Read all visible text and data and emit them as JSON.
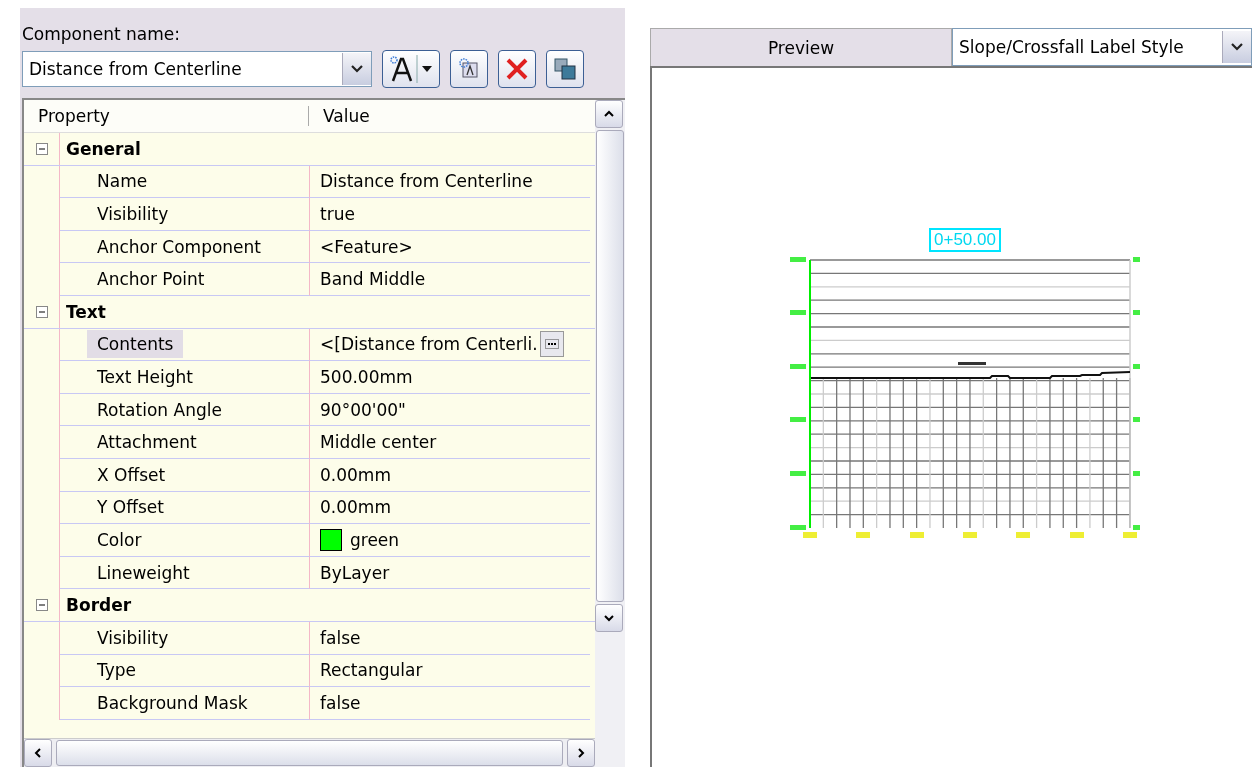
{
  "component": {
    "label": "Component name:",
    "value": "Distance from Centerline"
  },
  "grid": {
    "columns": [
      "Property",
      "Value"
    ],
    "categories": [
      {
        "label": "General",
        "expanded": true,
        "rows": [
          {
            "name": "Name",
            "value": "Distance from Centerline",
            "kind": "text",
            "selected": false
          },
          {
            "name": "Visibility",
            "value": "true",
            "kind": "text",
            "selected": false
          },
          {
            "name": "Anchor Component",
            "value": "<Feature>",
            "kind": "text",
            "selected": false
          },
          {
            "name": "Anchor Point",
            "value": "Band Middle",
            "kind": "text",
            "selected": false
          }
        ]
      },
      {
        "label": "Text",
        "expanded": true,
        "rows": [
          {
            "name": "Contents",
            "value": "<[Distance from Centerli.",
            "kind": "ellipsis",
            "selected": true
          },
          {
            "name": "Text Height",
            "value": "500.00mm",
            "kind": "text",
            "selected": false
          },
          {
            "name": "Rotation Angle",
            "value": "90°00'00\"",
            "kind": "text",
            "selected": false
          },
          {
            "name": "Attachment",
            "value": "Middle center",
            "kind": "text",
            "selected": false
          },
          {
            "name": "X Offset",
            "value": "0.00mm",
            "kind": "text",
            "selected": false
          },
          {
            "name": "Y Offset",
            "value": "0.00mm",
            "kind": "text",
            "selected": false
          },
          {
            "name": "Color",
            "value": "green",
            "kind": "color",
            "color": "#00ff00",
            "selected": false
          },
          {
            "name": "Lineweight",
            "value": "ByLayer",
            "kind": "text",
            "selected": false
          }
        ]
      },
      {
        "label": "Border",
        "expanded": true,
        "rows": [
          {
            "name": "Visibility",
            "value": "false",
            "kind": "text",
            "selected": false
          },
          {
            "name": "Type",
            "value": "Rectangular",
            "kind": "text",
            "selected": false
          },
          {
            "name": "Background Mask",
            "value": "false",
            "kind": "text",
            "selected": false
          }
        ]
      }
    ]
  },
  "preview": {
    "tab": "Preview",
    "style": "Slope/Crossfall Label Style",
    "station_label": "0+50.00"
  }
}
